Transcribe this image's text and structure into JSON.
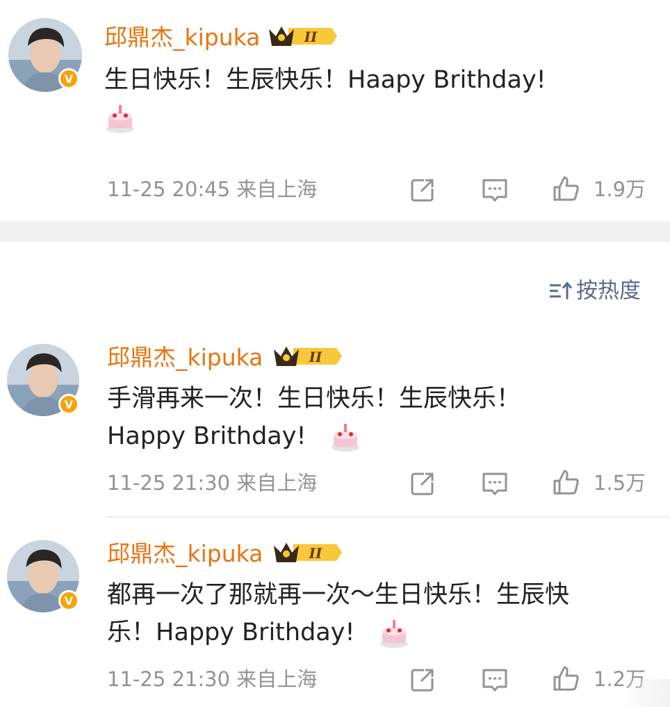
{
  "post": {
    "username": "邱鼎杰_kipuka",
    "text_line1": "生日快乐！生辰快乐！Haapy Brithday!",
    "emoji": "cake",
    "time": "11-25 20:45",
    "source": "来自上海",
    "likes": "1.9万"
  },
  "comments_header": {
    "sort_label": "按热度"
  },
  "comments": [
    {
      "username": "邱鼎杰_kipuka",
      "text_line1": "手滑再来一次！生日快乐！生辰快乐！",
      "text_line2": "Happy Brithday!",
      "time": "11-25 21:30",
      "source": "来自上海",
      "likes": "1.5万"
    },
    {
      "username": "邱鼎杰_kipuka",
      "text_line1": "都再一次了那就再一次～生日快乐！生辰快",
      "text_line2": "乐！Happy Brithday!",
      "time": "11-25 21:30",
      "source": "来自上海",
      "likes": "1.2万"
    }
  ],
  "badge": {
    "level": "II",
    "verified_mark": "V"
  },
  "colors": {
    "username": "#e8740f",
    "meta": "#939393",
    "sort": "#5a6b8a",
    "band": "#f1f1f1",
    "badge_orange": "#f5a30a"
  },
  "icons": [
    "share-icon",
    "comment-icon",
    "like-icon",
    "sort-icon",
    "crown-icon",
    "cake-emoji"
  ]
}
